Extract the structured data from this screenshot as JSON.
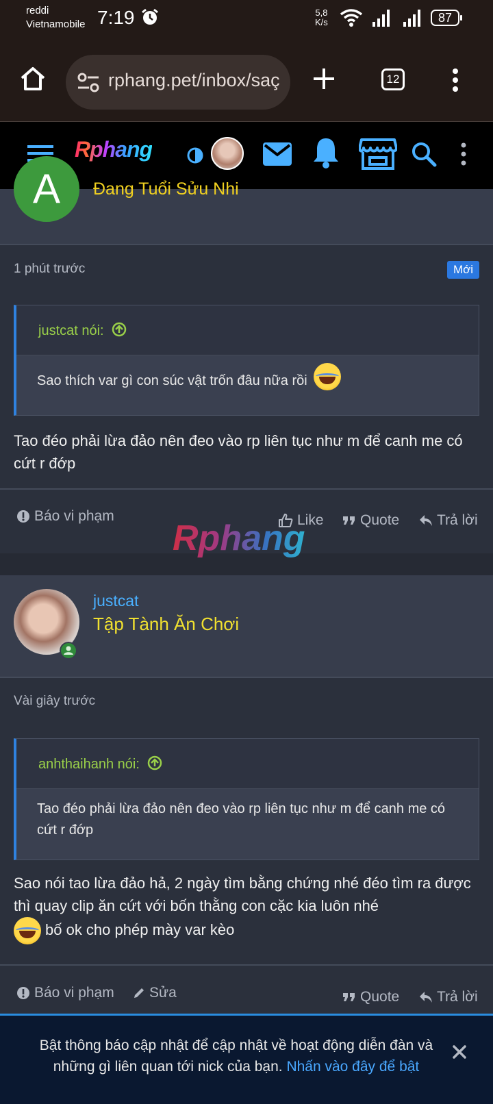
{
  "status_bar": {
    "carrier_line1": "reddi",
    "carrier_line2": "Vietnamobile",
    "time": "7:19",
    "speed_value": "5,8",
    "speed_unit": "K/s",
    "battery": "87"
  },
  "browser": {
    "url": "rphang.pet/inbox/saç",
    "tab_count": "12"
  },
  "site": {
    "logo_text": "Rphang"
  },
  "post1": {
    "rank": "Đang Tuổi Sửu Nhi",
    "avatar_letter": "A",
    "time": "1 phút trước",
    "badge": "Mới",
    "quote_author": "justcat nói:",
    "quote_text": "Sao thích var gì con súc vật trốn đâu nữa rồi",
    "message": "Tao đéo phải lừa đảo nên đeo vào rp liên tục như m để canh me có cứt r đớp",
    "report_label": "Báo vi phạm",
    "like_label": "Like",
    "quote_label": "Quote",
    "reply_label": "Trả lời"
  },
  "watermark": "Rphang",
  "post2": {
    "username": "justcat",
    "rank": "Tập Tành Ăn Chơi",
    "time": "Vài giây trước",
    "quote_author": "anhthaihanh nói:",
    "quote_text": "Tao đéo phải lừa đảo nên đeo vào rp liên tục như m để canh me có cứt r đớp",
    "message_part1": "Sao nói tao lừa đảo hả, 2 ngày tìm bằng chứng nhé đéo tìm ra được thì quay clip ăn cứt với bốn thằng con cặc kia luôn nhé",
    "message_part2": "bố ok cho phép mày var kèo",
    "report_label": "Báo vi phạm",
    "edit_label": "Sửa",
    "quote_label": "Quote",
    "reply_label": "Trả lời"
  },
  "notification": {
    "text": "Bật thông báo cập nhật để cập nhật về hoạt động diễn đàn và những gì liên quan tới nick của bạn.",
    "link": "Nhấn vào đây để bật"
  }
}
